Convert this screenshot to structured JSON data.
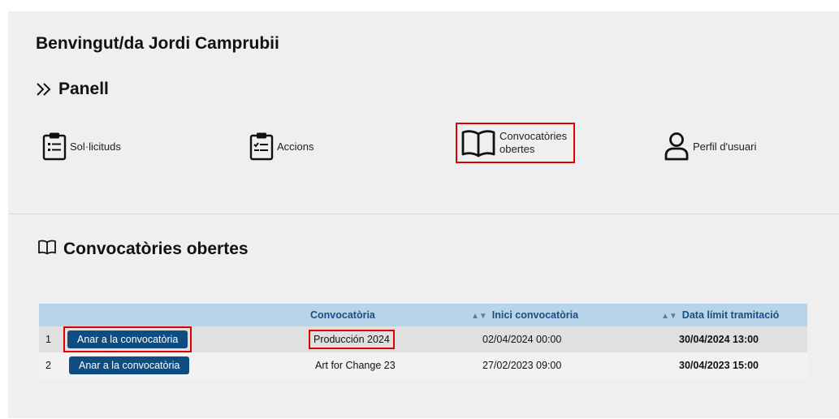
{
  "header": {
    "welcome": "Benvingut/da Jordi Camprubii",
    "panel_title": "Panell"
  },
  "tiles": [
    {
      "label": "Sol·licituds",
      "icon": "clipboard-list-icon"
    },
    {
      "label": "Accions",
      "icon": "clipboard-check-icon"
    },
    {
      "label_line1": "Convocatòries",
      "label_line2": "obertes",
      "icon": "open-book-icon"
    },
    {
      "label": "Perfil d'usuari",
      "icon": "user-icon"
    }
  ],
  "section": {
    "title": "Convocatòries obertes"
  },
  "table": {
    "columns": [
      "",
      "Convocatòria",
      "Inici convocatòria",
      "Data límit tramitació"
    ],
    "rows": [
      {
        "num": "1",
        "button": "Anar a la convocatòria",
        "convocatoria": "Producción 2024",
        "inici": "02/04/2024 00:00",
        "limit": "30/04/2024 13:00"
      },
      {
        "num": "2",
        "button": "Anar a la convocatòria",
        "convocatoria": "Art for Change 23",
        "inici": "27/02/2023 09:00",
        "limit": "30/04/2023 15:00"
      }
    ]
  },
  "colors": {
    "accent": "#0f4c81",
    "header_bg": "#b8d4e9",
    "highlight": "#e00000"
  }
}
